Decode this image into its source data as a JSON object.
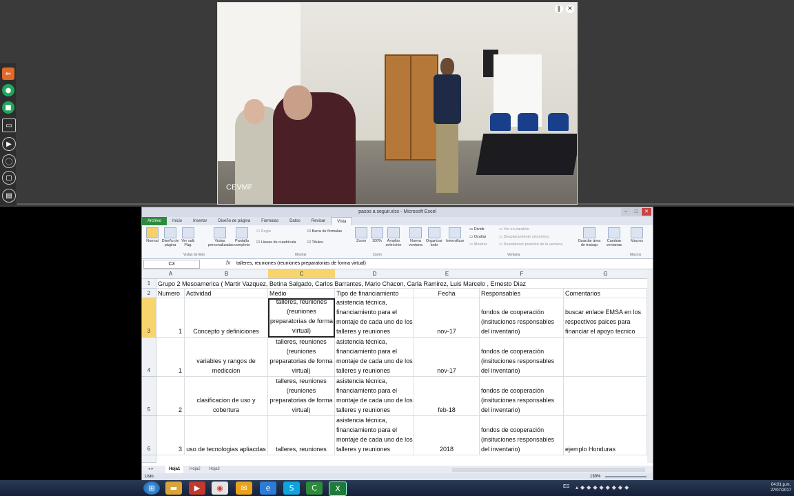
{
  "video": {
    "label": "CEVMF"
  },
  "side_toolbar": {
    "icons": [
      "share-icon",
      "microphone-icon",
      "camera-icon",
      "screen-icon",
      "play-icon",
      "mouse-icon",
      "monitor-icon",
      "layout-icon"
    ]
  },
  "excel": {
    "title": "pasos a seguir.xlsx - Microsoft Excel",
    "tabs": [
      "Archivo",
      "Inicio",
      "Insertar",
      "Diseño de página",
      "Fórmulas",
      "Datos",
      "Revisar",
      "Vista"
    ],
    "ribbon": {
      "normal": "Normal",
      "page_layout": "Diseño de página",
      "page_break": "Ver salt. Pág.",
      "custom_views": "Vistas personalizadas",
      "full_screen": "Pantalla completa",
      "group_views": "Vistas de libro",
      "ruler": "Regla",
      "formula_bar": "Barra de fórmulas",
      "gridlines": "Líneas de cuadrícula",
      "headings": "Títulos",
      "group_show": "Mostrar",
      "zoom": "Zoom",
      "zoom100": "100%",
      "zoom_sel": "Ampliar selección",
      "group_zoom": "Zoom",
      "new_window": "Nueva ventana",
      "arrange_all": "Organizar todo",
      "freeze": "Inmovilizar",
      "split": "Dividir",
      "hide": "Ocultar",
      "show": "Mostrar",
      "side_by_side": "Ver en paralelo",
      "sync_scroll": "Desplazamiento sincrónico",
      "reset_pos": "Restablecer posición de la ventana",
      "save_workspace": "Guardar área de trabajo",
      "switch_windows": "Cambiar ventanas",
      "group_window": "Ventana",
      "macros": "Macros",
      "group_macros": "Macros"
    },
    "name_box": "C3",
    "formula_text": "talleres, reuniones (reuniones preparatorias de forma virtual)",
    "columns": [
      "A",
      "B",
      "C",
      "D",
      "E",
      "F",
      "G"
    ],
    "rows": {
      "r1": {
        "num": "1",
        "text": "Grupo 2 Mesoamerica ( Martir Vazquez, Betina Salgado, Carlos Barrantes, Mario Chacon, Carla Ramirez, Luis Marcelo , Ernesto Diaz"
      },
      "r2": {
        "num": "2",
        "A": "Numero",
        "B": "Actividad",
        "C": "Medio",
        "D": "Tipo de financiamiento",
        "E": "Fecha",
        "F": "Responsables",
        "G": "Comentarios"
      },
      "r3": {
        "num": "3",
        "A": "1",
        "B": "Concepto y definiciones",
        "C": "talleres, reuniones (reuniones preparatorias de forma virtual)",
        "D": "asistencia técnica, financiamiento para el montaje de cada uno de los talleres y reuniones",
        "E": "nov-17",
        "F": "fondos de cooperación (insituciones responsables del inventario)",
        "G": "buscar enlace EMSA en los respectivos paices para financiar el apoyo tecnico"
      },
      "r4": {
        "num": "4",
        "A": "1",
        "B": "variables  y rangos de mediccion",
        "C": "talleres, reuniones (reuniones preparatorias de forma virtual)",
        "D": "asistencia técnica, financiamiento para el montaje de cada uno de los talleres y reuniones",
        "E": "nov-17",
        "F": "fondos de cooperación (insituciones responsables del inventario)",
        "G": ""
      },
      "r5": {
        "num": "5",
        "A": "2",
        "B": "clasificacion de uso y cobertura",
        "C": "talleres, reuniones (reuniones preparatorias de forma virtual)",
        "D": "asistencia técnica, financiamiento para el montaje de cada uno de los talleres y reuniones",
        "E": "feb-18",
        "F": "fondos de cooperación (insituciones responsables del inventario)",
        "G": ""
      },
      "r6": {
        "num": "6",
        "A": "3",
        "B": "uso de tecnologias apliacdas",
        "C": "talleres, reuniones",
        "D": "asistencia técnica, financiamiento para el montaje de cada uno de los talleres y reuniones",
        "E": "2018",
        "F": "fondos de cooperación (insituciones responsables del inventario)",
        "G": "ejemplo Honduras"
      }
    },
    "sheets": [
      "Hoja1",
      "Hoja2",
      "Hoja3"
    ],
    "status": "Listo",
    "zoom_level": "130%"
  },
  "taskbar": {
    "lang": "ES",
    "time": "04:01 p.m.",
    "date": "27/07/2017"
  }
}
